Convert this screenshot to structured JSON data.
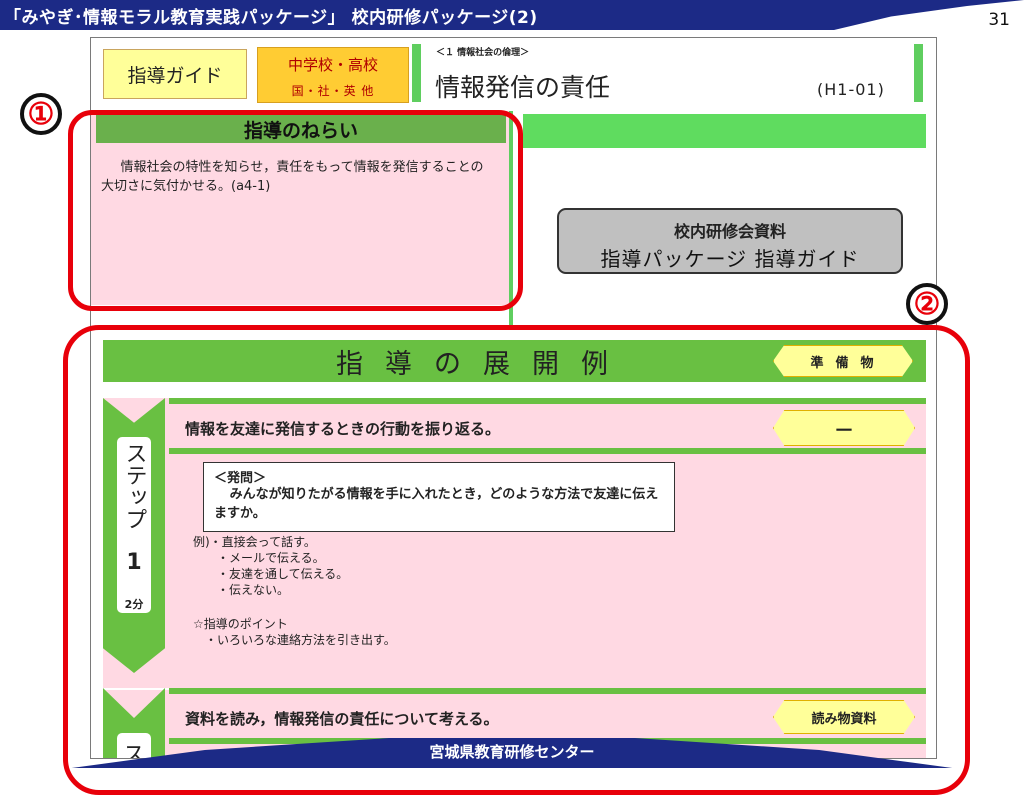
{
  "slide": {
    "title": "「みやぎ･情報モラル教育実践パッケージ」 校内研修パッケージ(2)",
    "page_number": "31",
    "footer": "宮城県教育研修センター"
  },
  "guide": {
    "label": "指導ガイド",
    "school_level": "中学校・高校",
    "subjects": "国・社・英 他",
    "unit_label": "＜１ 情報社会の倫理＞",
    "unit_title": "情報発信の責任",
    "unit_code": "(H1-01)"
  },
  "aim": {
    "header": "指導のねらい",
    "text": "情報社会の特性を知らせ，責任をもって情報を発信することの大切さに気付かせる。(a4-1)"
  },
  "resource_box": {
    "line1": "校内研修会資料",
    "line2": "指導パッケージ 指導ガイド"
  },
  "development": {
    "title": "指導の展開例",
    "prep_label": "準備物"
  },
  "step1": {
    "label": "ステップ",
    "number": "1",
    "minutes": "2分",
    "heading": "情報を友達に発信するときの行動を振り返る。",
    "material": "－",
    "question_label": "＜発問＞",
    "question": "みんなが知りたがる情報を手に入れたとき，どのような方法で友達に伝えますか。",
    "examples": [
      "例)・直接会って話す。",
      "　　・メールで伝える。",
      "　　・友達を通して伝える。",
      "　　・伝えない。"
    ],
    "point_label": "☆指導のポイント",
    "point": "　・いろいろな連絡方法を引き出す。"
  },
  "step2": {
    "label_char": "ス",
    "heading": "資料を読み，情報発信の責任について考える。",
    "material": "読み物資料"
  },
  "annotations": {
    "badge_1": "①",
    "badge_2": "②",
    "highlight_color": "#e8000a"
  }
}
